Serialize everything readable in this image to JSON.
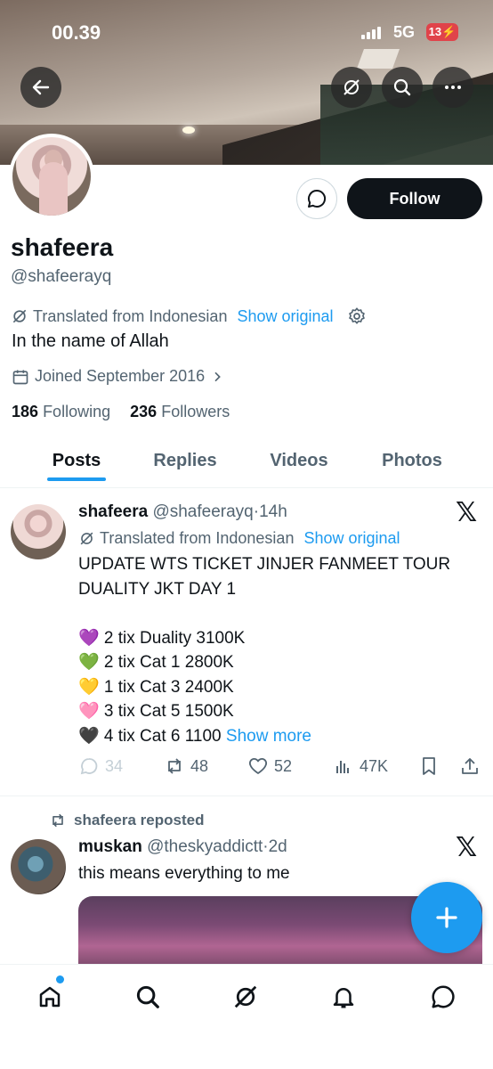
{
  "status_bar": {
    "time": "00.39",
    "network": "5G",
    "battery": "13"
  },
  "profile": {
    "name": "shafeera",
    "handle": "@shafeerayq",
    "translated_from": "Translated from Indonesian",
    "show_original": "Show original",
    "bio": "In the name of Allah",
    "joined": "Joined September 2016",
    "following_count": "186",
    "following_label": "Following",
    "followers_count": "236",
    "followers_label": "Followers",
    "follow_label": "Follow"
  },
  "tabs": [
    {
      "label": "Posts",
      "active": true
    },
    {
      "label": "Replies"
    },
    {
      "label": "Videos"
    },
    {
      "label": "Photos"
    }
  ],
  "posts": [
    {
      "name": "shafeera",
      "handle": "@shafeerayq",
      "time": "14h",
      "translated_from": "Translated from Indonesian",
      "show_original": "Show original",
      "title_line1": "UPDATE WTS TICKET JINJER FANMEET TOUR",
      "title_line2": "DUALITY JKT DAY 1",
      "lines": [
        "💜 2 tix Duality 3100K",
        "💚 2 tix Cat 1 2800K",
        "💛 1 tix Cat 3 2400K",
        "🩷 3 tix Cat 5 1500K",
        "🖤 4 tix Cat 6 1100"
      ],
      "show_more": "Show more",
      "replies": "34",
      "reposts": "48",
      "likes": "52",
      "views": "47K"
    },
    {
      "repost_label": "shafeera reposted",
      "name": "muskan",
      "handle": "@theskyaddictt",
      "time": "2d",
      "text": "this means everything to me"
    }
  ],
  "colors": {
    "accent": "#1d9bf0",
    "text": "#0f1419",
    "muted": "#536471"
  }
}
